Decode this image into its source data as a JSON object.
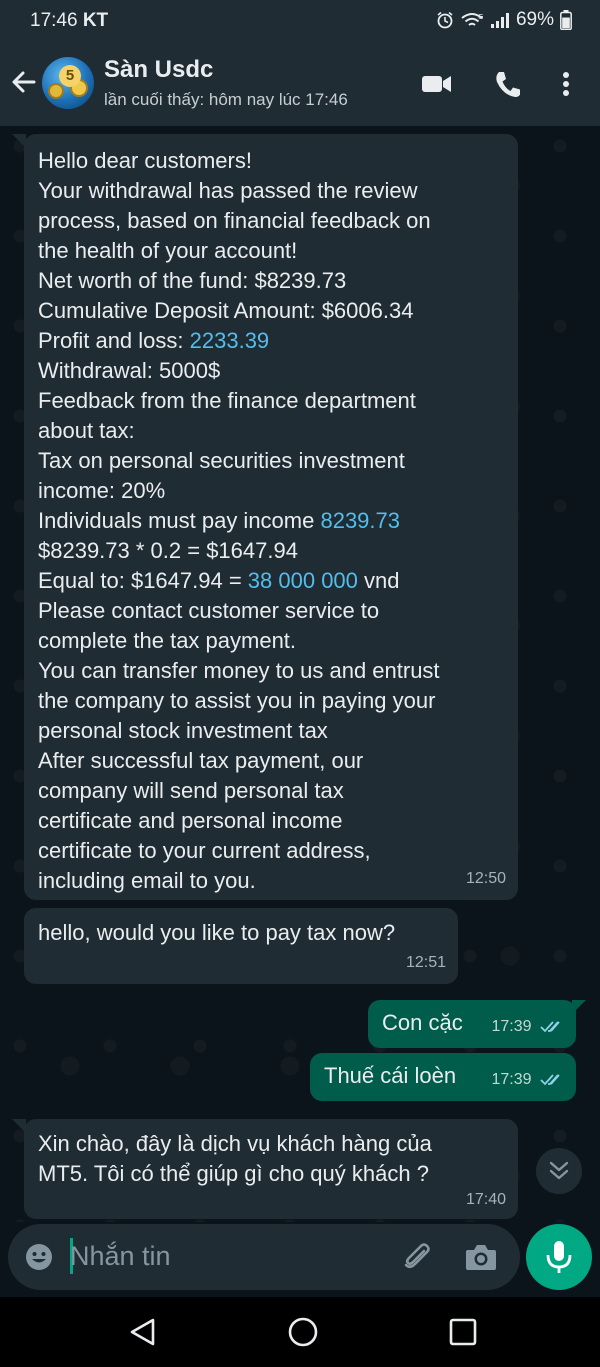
{
  "status_bar": {
    "time": "17:46",
    "carrier": "KT",
    "battery": "69%",
    "icons": [
      "alarm-icon",
      "wifi-icon",
      "signal-icon",
      "battery-icon"
    ]
  },
  "header": {
    "contact_name": "Sàn Usdc",
    "last_seen": "lần cuối thấy: hôm nay lúc 17:46",
    "avatar_badge": "5"
  },
  "messages": [
    {
      "direction": "in",
      "lines": [
        [
          "Hello dear customers!"
        ],
        [
          "Your withdrawal has passed the review"
        ],
        [
          "process, based on financial feedback on"
        ],
        [
          "the health of your account!"
        ],
        [
          "Net worth of the fund: $8239.73"
        ],
        [
          "Cumulative Deposit Amount: $6006.34"
        ],
        [
          "Profit and loss: ",
          "2233.39"
        ],
        [
          "Withdrawal: 5000$"
        ],
        [
          "Feedback from the finance department"
        ],
        [
          "about tax:"
        ],
        [
          "Tax on personal securities investment"
        ],
        [
          "income: 20%"
        ],
        [
          "Individuals must pay income ",
          "8239.73"
        ],
        [
          "$8239.73 * 0.2 = $1647.94"
        ],
        [
          "Equal to: $1647.94 = ",
          "38 000 000",
          " vnd"
        ],
        [
          "Please contact customer service to"
        ],
        [
          "complete the tax payment."
        ],
        [
          "You can transfer money to us and entrust"
        ],
        [
          "the company to assist you in paying your"
        ],
        [
          "personal stock investment tax"
        ],
        [
          "After successful tax payment, our"
        ],
        [
          "company will send personal tax"
        ],
        [
          "certificate and personal income"
        ],
        [
          "certificate to your current address,"
        ],
        [
          "including email to you."
        ]
      ],
      "time": "12:50"
    },
    {
      "direction": "in",
      "lines": [
        [
          "hello, would you like to pay tax now?"
        ]
      ],
      "time": "12:51"
    },
    {
      "direction": "out",
      "lines": [
        [
          "Con cặc"
        ]
      ],
      "time": "17:39",
      "status": "read"
    },
    {
      "direction": "out",
      "lines": [
        [
          "Thuế cái loèn"
        ]
      ],
      "time": "17:39",
      "status": "read"
    },
    {
      "direction": "in",
      "lines": [
        [
          "Xin chào, đây là dịch vụ khách hàng của"
        ],
        [
          "MT5. Tôi có thể giúp gì cho quý khách ?"
        ]
      ],
      "time": "17:40"
    }
  ],
  "composer": {
    "placeholder": "Nhắn tin"
  },
  "colors": {
    "header_bg": "#1f2c34",
    "chat_bg": "#0b141a",
    "incoming_bubble": "#202c33",
    "outgoing_bubble": "#005c4b",
    "link_blue": "#53bdeb",
    "accent_green": "#00a884",
    "read_ticks": "#8ed1e8"
  }
}
